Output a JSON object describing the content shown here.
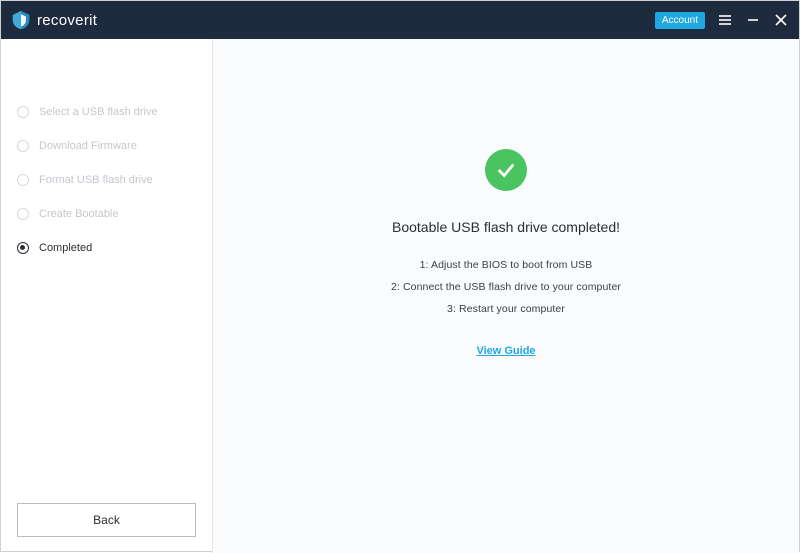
{
  "header": {
    "brand": "recoverit",
    "account_label": "Account"
  },
  "sidebar": {
    "steps": [
      {
        "label": "Select a USB flash drive",
        "active": false
      },
      {
        "label": "Download Firmware",
        "active": false
      },
      {
        "label": "Format USB flash drive",
        "active": false
      },
      {
        "label": "Create Bootable",
        "active": false
      },
      {
        "label": "Completed",
        "active": true
      }
    ],
    "back_label": "Back"
  },
  "main": {
    "title": "Bootable USB flash drive completed!",
    "instructions": [
      "1: Adjust the BIOS to boot from USB",
      "2: Connect the USB flash drive to your computer",
      "3: Restart your computer"
    ],
    "guide_label": "View Guide"
  }
}
